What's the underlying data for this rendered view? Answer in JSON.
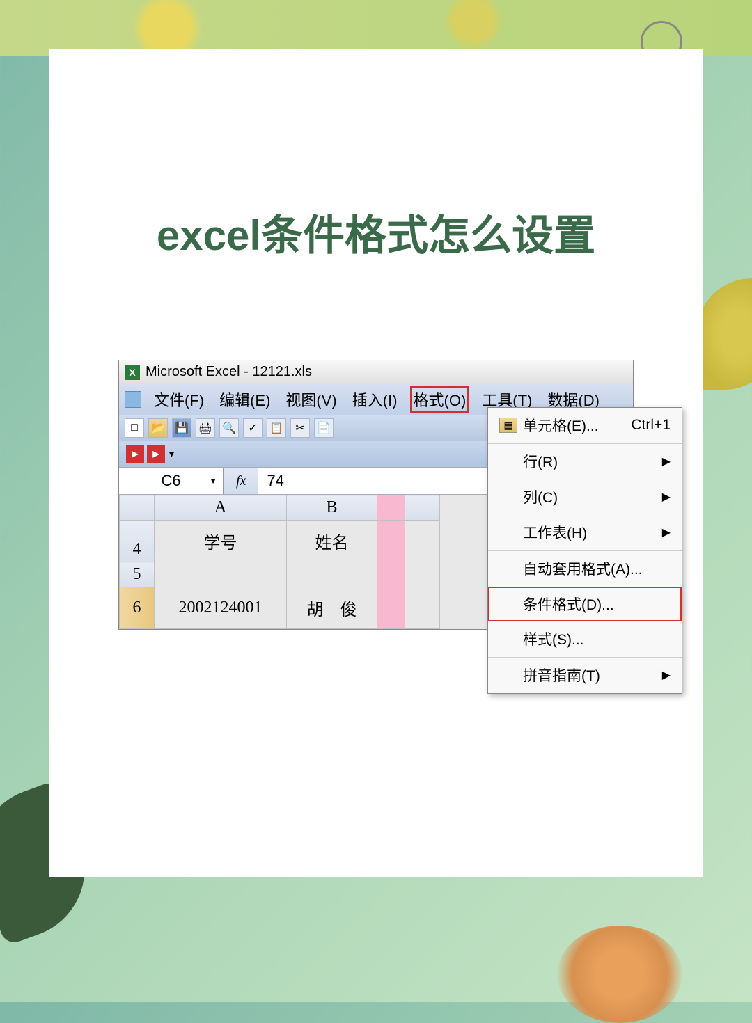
{
  "page_title": "excel条件格式怎么设置",
  "window_title": "Microsoft Excel - 12121.xls",
  "menubar": {
    "file": "文件(F)",
    "edit": "编辑(E)",
    "view": "视图(V)",
    "insert": "插入(I)",
    "format": "格式(O)",
    "tools": "工具(T)",
    "data": "数据(D)"
  },
  "namebox": "C6",
  "fx_label": "fx",
  "formula_value": "74",
  "columns": {
    "a": "A",
    "b": "B"
  },
  "rows": {
    "r4": "4",
    "r5": "5",
    "r6": "6"
  },
  "cells": {
    "a4": "学号",
    "b4": "姓名",
    "a6": "2002124001",
    "b6": "胡　俊"
  },
  "dropdown": {
    "cells": "单元格(E)...",
    "cells_shortcut": "Ctrl+1",
    "row": "行(R)",
    "column": "列(C)",
    "sheet": "工作表(H)",
    "autoformat": "自动套用格式(A)...",
    "conditional": "条件格式(D)...",
    "style": "样式(S)...",
    "phonetic": "拼音指南(T)"
  }
}
